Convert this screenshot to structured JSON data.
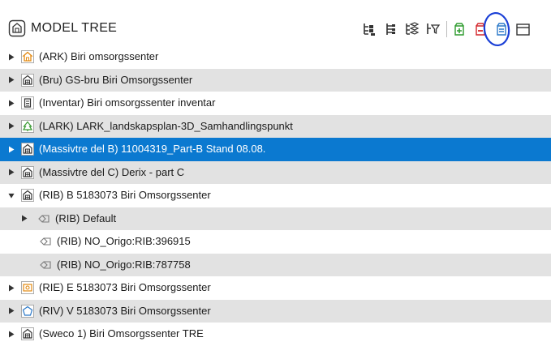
{
  "header": {
    "title": "MODEL TREE",
    "title_icon": "model-tree-icon"
  },
  "toolbar": {
    "buttons": [
      {
        "icon": "tree-hierarchy-icon"
      },
      {
        "icon": "tree-list-icon"
      },
      {
        "icon": "layers-tree-icon"
      },
      {
        "icon": "tree-filter-icon"
      },
      {
        "icon": "expand-all-icon"
      },
      {
        "icon": "collapse-all-icon"
      },
      {
        "icon": "list-document-icon"
      },
      {
        "icon": "panel-icon"
      }
    ]
  },
  "annotation": {
    "color": "#1a3fd6"
  },
  "colors": {
    "selected_row": "#0b79d0",
    "alt_row": "#e2e2e2",
    "expand_green": "#2e9b2e",
    "collapse_red": "#d3262b",
    "icon_orange": "#e38a12",
    "icon_green": "#3a9a32",
    "icon_blue": "#2a78c8"
  },
  "tree": {
    "rows": [
      {
        "label": "(ARK) Biri omsorgssenter",
        "icon": "house-icon",
        "depth": 0,
        "caret": "right",
        "alt": false,
        "selected": false
      },
      {
        "label": "(Bru) GS-bru Biri Omsorgssenter",
        "icon": "building-icon",
        "depth": 0,
        "caret": "right",
        "alt": true,
        "selected": false
      },
      {
        "label": "(Inventar) Biri omsorgssenter inventar",
        "icon": "inventory-icon",
        "depth": 0,
        "caret": "right",
        "alt": false,
        "selected": false
      },
      {
        "label": "(LARK) LARK_landskapsplan-3D_Samhandlingspunkt",
        "icon": "landscape-icon",
        "depth": 0,
        "caret": "right",
        "alt": true,
        "selected": false
      },
      {
        "label": "(Massivtre del B) 11004319_Part-B Stand 08.08.",
        "icon": "building-icon",
        "depth": 0,
        "caret": "right",
        "alt": false,
        "selected": true
      },
      {
        "label": "(Massivtre del C) Derix - part C",
        "icon": "building-icon",
        "depth": 0,
        "caret": "right",
        "alt": true,
        "selected": false
      },
      {
        "label": "(RIB) B 5183073 Biri Omsorgssenter",
        "icon": "building-icon",
        "depth": 0,
        "caret": "down",
        "alt": false,
        "selected": false
      },
      {
        "label": "(RIB) Default",
        "icon": "structure-icon",
        "depth": 1,
        "caret": "right",
        "alt": true,
        "selected": false
      },
      {
        "label": "(RIB) NO_Origo:RIB:396915",
        "icon": "structure-icon",
        "depth": 1,
        "caret": "none",
        "alt": false,
        "selected": false
      },
      {
        "label": "(RIB) NO_Origo:RIB:787758",
        "icon": "structure-icon",
        "depth": 1,
        "caret": "none",
        "alt": true,
        "selected": false
      },
      {
        "label": "(RIE) E 5183073 Biri Omsorgssenter",
        "icon": "electrical-icon",
        "depth": 0,
        "caret": "right",
        "alt": false,
        "selected": false
      },
      {
        "label": "(RIV) V 5183073 Biri Omsorgssenter",
        "icon": "plumbing-icon",
        "depth": 0,
        "caret": "right",
        "alt": true,
        "selected": false
      },
      {
        "label": "(Sweco 1) Biri Omsorgssenter TRE",
        "icon": "building-icon",
        "depth": 0,
        "caret": "right",
        "alt": false,
        "selected": false
      }
    ]
  }
}
